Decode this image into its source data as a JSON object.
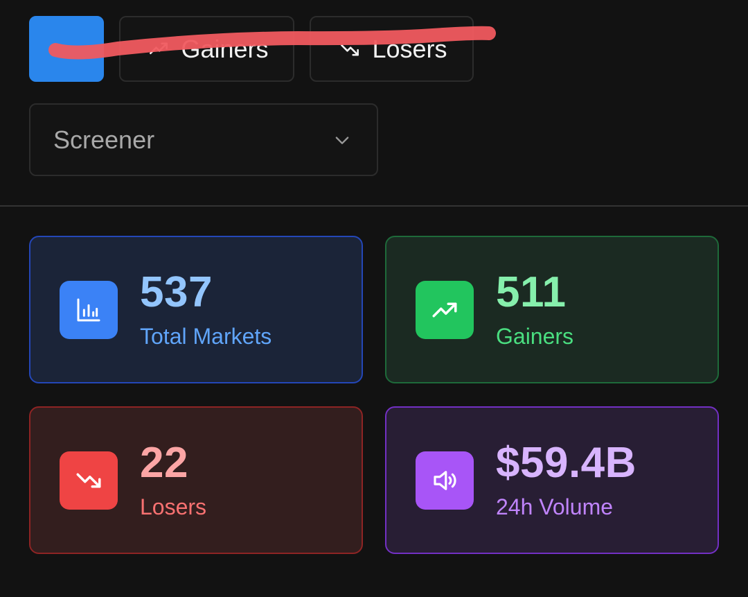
{
  "filters": {
    "all_label": "",
    "gainers_label": "Gainers",
    "losers_label": "Losers"
  },
  "select": {
    "value": "Screener",
    "icon": "chevron-down-icon"
  },
  "stats": {
    "total": {
      "value": "537",
      "label": "Total Markets",
      "icon": "bar-chart-icon"
    },
    "gainers": {
      "value": "511",
      "label": "Gainers",
      "icon": "trending-up-icon"
    },
    "losers": {
      "value": "22",
      "label": "Losers",
      "icon": "trending-down-icon"
    },
    "volume": {
      "value": "$59.4B",
      "label": "24h Volume",
      "icon": "volume-icon"
    }
  },
  "colors": {
    "accent": "#2a86ec",
    "blue": "#3b82f6",
    "green": "#22c55e",
    "red": "#ef4444",
    "purple": "#a855f7",
    "annotation": "#f05a5f"
  }
}
